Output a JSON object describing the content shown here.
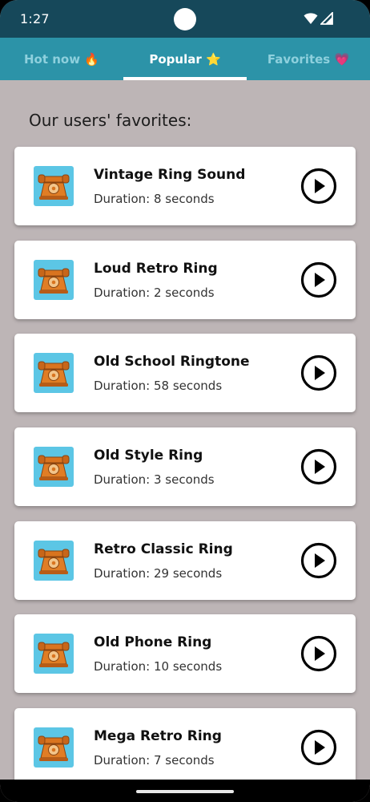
{
  "status_bar": {
    "time": "1:27",
    "icons": [
      "wifi-icon",
      "cell-signal-icon"
    ]
  },
  "tabs": [
    {
      "label": "Hot now 🔥",
      "selected": false
    },
    {
      "label": "Popular ⭐",
      "selected": true
    },
    {
      "label": "Favorites 💗",
      "selected": false
    }
  ],
  "section_title": "Our users' favorites:",
  "ringtones": [
    {
      "title": "Vintage Ring Sound",
      "duration": "Duration: 8 seconds",
      "icon": "retro-phone-icon"
    },
    {
      "title": "Loud Retro Ring",
      "duration": "Duration: 2 seconds",
      "icon": "retro-phone-icon"
    },
    {
      "title": "Old School Ringtone",
      "duration": "Duration: 58 seconds",
      "icon": "retro-phone-icon"
    },
    {
      "title": "Old Style Ring",
      "duration": "Duration: 3 seconds",
      "icon": "retro-phone-icon"
    },
    {
      "title": "Retro Classic Ring",
      "duration": "Duration: 29 seconds",
      "icon": "retro-phone-icon"
    },
    {
      "title": "Old Phone Ring",
      "duration": "Duration: 10 seconds",
      "icon": "retro-phone-icon"
    },
    {
      "title": "Mega Retro Ring",
      "duration": "Duration: 7 seconds",
      "icon": "retro-phone-icon"
    }
  ],
  "colors": {
    "status_bar": "#16485a",
    "tab_bar": "#2c93a8",
    "background": "#bdb5b6",
    "thumb_bg": "#5cc6e5",
    "phone_orange": "#d9741f"
  }
}
